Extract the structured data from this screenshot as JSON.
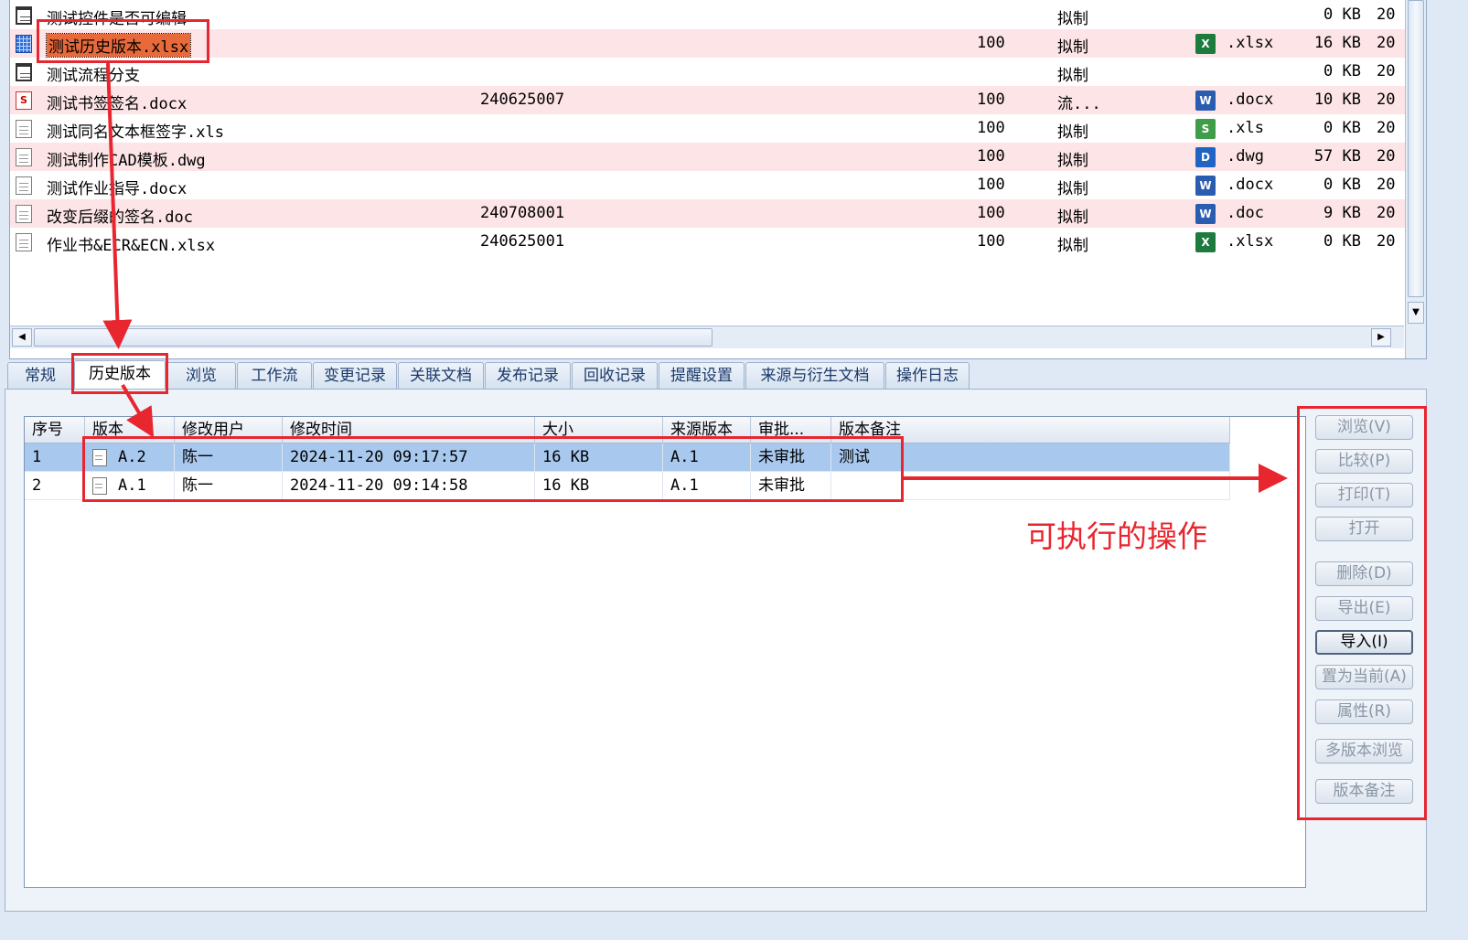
{
  "files": [
    {
      "name": "测试控件是否可编辑",
      "code": "",
      "version": "",
      "state": "拟制",
      "type": "",
      "type_icon": "",
      "size": "0 KB",
      "date": "20",
      "icon": "form-icon"
    },
    {
      "name": "测试历史版本.xlsx",
      "code": "",
      "version": "100",
      "state": "拟制",
      "type": ".xlsx",
      "type_icon": "X",
      "size": "16 KB",
      "date": "20",
      "icon": "spreadsheet-icon",
      "selected": true
    },
    {
      "name": "测试流程分支",
      "code": "",
      "version": "",
      "state": "拟制",
      "type": "",
      "type_icon": "",
      "size": "0 KB",
      "date": "20",
      "icon": "form-icon"
    },
    {
      "name": "测试书签签名.docx",
      "code": "240625007",
      "version": "100",
      "state": "流...",
      "type": ".docx",
      "type_icon": "W",
      "size": "10 KB",
      "date": "20",
      "icon": "signed-doc-icon"
    },
    {
      "name": "测试同名文本框签字.xls",
      "code": "",
      "version": "100",
      "state": "拟制",
      "type": ".xls",
      "type_icon": "S",
      "size": "0 KB",
      "date": "20",
      "icon": "document-icon"
    },
    {
      "name": "测试制作CAD模板.dwg",
      "code": "",
      "version": "100",
      "state": "拟制",
      "type": ".dwg",
      "type_icon": "D",
      "size": "57 KB",
      "date": "20",
      "icon": "document-icon"
    },
    {
      "name": "测试作业指导.docx",
      "code": "",
      "version": "100",
      "state": "拟制",
      "type": ".docx",
      "type_icon": "W",
      "size": "0 KB",
      "date": "20",
      "icon": "document-icon"
    },
    {
      "name": "改变后缀的签名.doc",
      "code": "240708001",
      "version": "100",
      "state": "拟制",
      "type": ".doc",
      "type_icon": "W",
      "size": "9 KB",
      "date": "20",
      "icon": "document-icon"
    },
    {
      "name": "作业书&ECR&ECN.xlsx",
      "code": "240625001",
      "version": "100",
      "state": "拟制",
      "type": ".xlsx",
      "type_icon": "X",
      "size": "0 KB",
      "date": "20",
      "icon": "document-icon"
    }
  ],
  "tabs": [
    "常规",
    "历史版本",
    "浏览",
    "工作流",
    "变更记录",
    "关联文档",
    "发布记录",
    "回收记录",
    "提醒设置",
    "来源与衍生文档",
    "操作日志"
  ],
  "active_tab": "历史版本",
  "history": {
    "columns": [
      "序号",
      "版本",
      "修改用户",
      "修改时间",
      "大小",
      "来源版本",
      "审批...",
      "版本备注"
    ],
    "rows": [
      {
        "idx": "1",
        "version": "A.2",
        "user": "陈一",
        "time": "2024-11-20 09:17:57",
        "size": "16 KB",
        "source": "A.1",
        "approval": "未审批",
        "note": "测试",
        "selected": true
      },
      {
        "idx": "2",
        "version": "A.1",
        "user": "陈一",
        "time": "2024-11-20 09:14:58",
        "size": "16 KB",
        "source": "A.1",
        "approval": "未审批",
        "note": ""
      }
    ]
  },
  "actions": [
    "浏览(V)",
    "比较(P)",
    "打印(T)",
    "打开",
    "删除(D)",
    "导出(E)",
    "导入(I)",
    "置为当前(A)",
    "属性(R)",
    "多版本浏览",
    "版本备注"
  ],
  "enabled_action": "导入(I)",
  "annotation_text": "可执行的操作",
  "colors": {
    "annotation": "#e8262f",
    "row_alt": "#fde4e6",
    "row_selected": "#a8c8ee"
  }
}
